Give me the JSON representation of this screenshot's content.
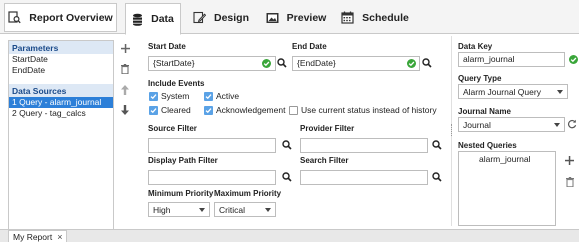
{
  "tabs": [
    {
      "label": "Report Overview",
      "icon": "magnifier-document-icon"
    },
    {
      "label": "Data",
      "icon": "database-icon"
    },
    {
      "label": "Design",
      "icon": "pencil-document-icon"
    },
    {
      "label": "Preview",
      "icon": "image-preview-icon"
    },
    {
      "label": "Schedule",
      "icon": "calendar-icon"
    }
  ],
  "left": {
    "parameters_header": "Parameters",
    "parameters": [
      "StartDate",
      "EndDate"
    ],
    "datasources_header": "Data Sources",
    "datasources": [
      "1 Query - alarm_journal",
      "2 Query - tag_calcs"
    ]
  },
  "form": {
    "start_date_label": "Start Date",
    "start_date_value": "{StartDate}",
    "end_date_label": "End Date",
    "end_date_value": "{EndDate}",
    "include_events_label": "Include Events",
    "system_label": "System",
    "active_label": "Active",
    "cleared_label": "Cleared",
    "ack_label": "Acknowledgement",
    "current_status_label": "Use current status instead of history",
    "source_filter_label": "Source Filter",
    "provider_filter_label": "Provider Filter",
    "display_path_label": "Display Path Filter",
    "search_filter_label": "Search Filter",
    "min_priority_label": "Minimum Priority",
    "max_priority_label": "Maximum Priority",
    "min_priority_value": "High",
    "max_priority_value": "Critical"
  },
  "right": {
    "data_key_label": "Data Key",
    "data_key_value": "alarm_journal",
    "query_type_label": "Query Type",
    "query_type_value": "Alarm Journal Query",
    "journal_name_label": "Journal Name",
    "journal_name_value": "Journal",
    "nested_queries_label": "Nested Queries",
    "nested_queries": [
      "alarm_journal"
    ]
  },
  "bottom_tab": {
    "label": "My Report",
    "close": "×"
  },
  "colors": {
    "accent": "#2c7fd8",
    "check": "#5aa2e6",
    "valid": "#3aa63a",
    "section_header": "#dde8f5"
  }
}
